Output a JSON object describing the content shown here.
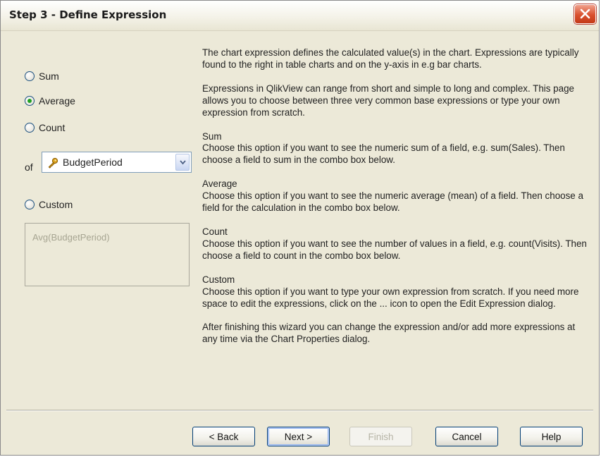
{
  "window": {
    "title": "Step 3 - Define Expression"
  },
  "options": {
    "sum": "Sum",
    "average": "Average",
    "count": "Count",
    "custom": "Custom",
    "selected": "average"
  },
  "field": {
    "of_label": "of",
    "value": "BudgetPeriod",
    "icon": "key-icon"
  },
  "custom_expression": {
    "value": "Avg(BudgetPeriod)"
  },
  "description": {
    "intro": "The chart expression defines the calculated value(s) in the chart. Expressions are typically found to the right in table charts and on the y-axis in e.g bar charts.",
    "range": "Expressions in QlikView can range from short and simple to long and complex. This page allows you to choose between three very common base expressions or type your own expression from scratch.",
    "sum_heading": "Sum",
    "sum_text": "Choose this option if you want to see the numeric sum of a field, e.g. sum(Sales). Then choose a field to sum in the combo box below.",
    "average_heading": "Average",
    "average_text": "Choose this option if you want to see the numeric average (mean) of a field. Then choose a field for the calculation in the combo box below.",
    "count_heading": "Count",
    "count_text": "Choose this option if you want to see the number of values in a field, e.g. count(Visits). Then choose a field to count in the combo box below.",
    "custom_heading": "Custom",
    "custom_text": "Choose this option if you want to type your own expression from scratch. If you need more space to edit the expressions, click on the ... icon to open the Edit Expression dialog.",
    "footer": "After finishing this wizard you can change the expression and/or add more expressions at any time via the Chart Properties dialog."
  },
  "buttons": {
    "back": "< Back",
    "next": "Next >",
    "finish": "Finish",
    "cancel": "Cancel",
    "help": "Help"
  },
  "colors": {
    "dialog_bg": "#ece9d8",
    "close_button": "#d9502e",
    "radio_dot": "#21a121",
    "button_border": "#003c74"
  }
}
